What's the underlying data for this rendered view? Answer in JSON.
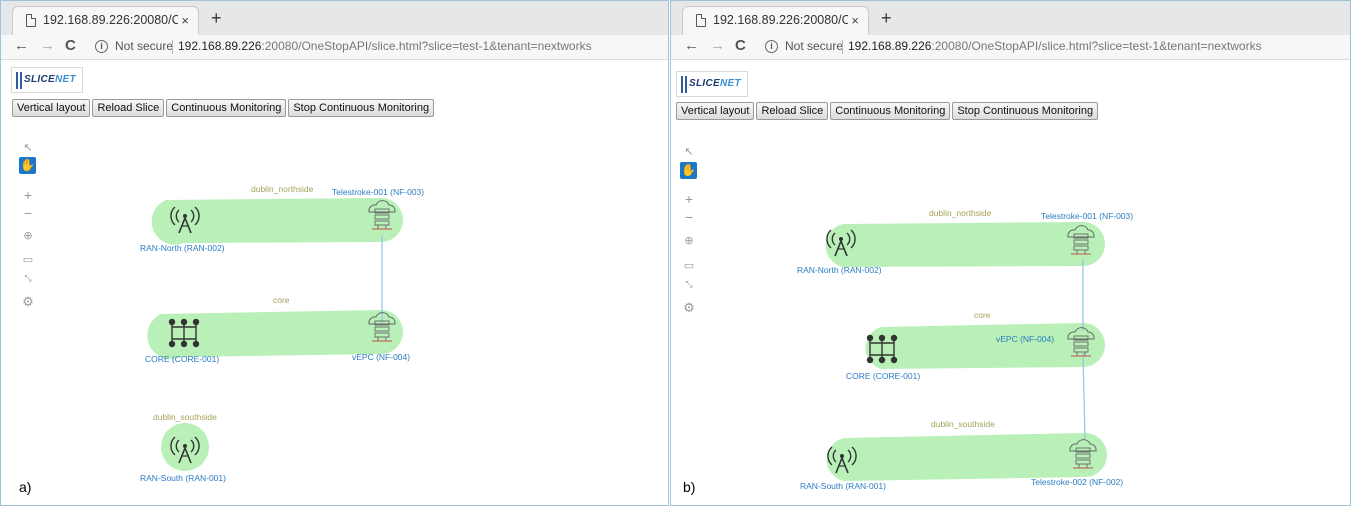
{
  "browser": {
    "tab_title": "192.168.89.226:20080/C",
    "tab_close": "×",
    "new_tab": "+",
    "not_secure": "Not secure",
    "url_host": "192.168.89.226",
    "url_rest": ":20080/OneStopAPI/slice.html?slice=test-1&tenant=nextworks"
  },
  "logo": {
    "part1": "SLICE",
    "part2": "NET"
  },
  "toolbar": {
    "vertical_layout": "Vertical layout",
    "reload_slice": "Reload Slice",
    "continuous_monitoring": "Continuous Monitoring",
    "stop_monitoring": "Stop Continuous Monitoring"
  },
  "panel_a": {
    "caption": "a)",
    "groups": {
      "north": "dublin_northside",
      "core": "core",
      "south": "dublin_southside"
    },
    "nodes": {
      "ran_north": "RAN-North (RAN-002)",
      "telestroke_001": "Telestroke-001 (NF-003)",
      "core": "CORE (CORE-001)",
      "vepc": "vEPC (NF-004)",
      "ran_south": "RAN-South (RAN-001)"
    }
  },
  "panel_b": {
    "caption": "b)",
    "groups": {
      "north": "dublin_northside",
      "core": "core",
      "south": "dublin_southside"
    },
    "nodes": {
      "ran_north": "RAN-North (RAN-002)",
      "telestroke_001": "Telestroke-001 (NF-003)",
      "core": "CORE (CORE-001)",
      "vepc": "vEPC (NF-004)",
      "ran_south": "RAN-South (RAN-001)",
      "telestroke_002": "Telestroke-002 (NF-002)"
    }
  },
  "icons": [
    "file-icon",
    "close-icon",
    "plus-icon",
    "back-icon",
    "forward-icon",
    "reload-icon",
    "info-icon",
    "pointer-icon",
    "hand-icon",
    "zoom-in-icon",
    "zoom-out-icon",
    "zoom-fit-icon",
    "select-area-icon",
    "fullscreen-icon",
    "gear-icon",
    "antenna-icon",
    "cloud-server-icon",
    "core-network-icon"
  ],
  "colors": {
    "group_fill": "#b8f0b8",
    "link": "#8cc6e0",
    "node_label": "#2b7cc4",
    "group_label": "#a6a35a",
    "hand_active": "#1b78c8"
  }
}
